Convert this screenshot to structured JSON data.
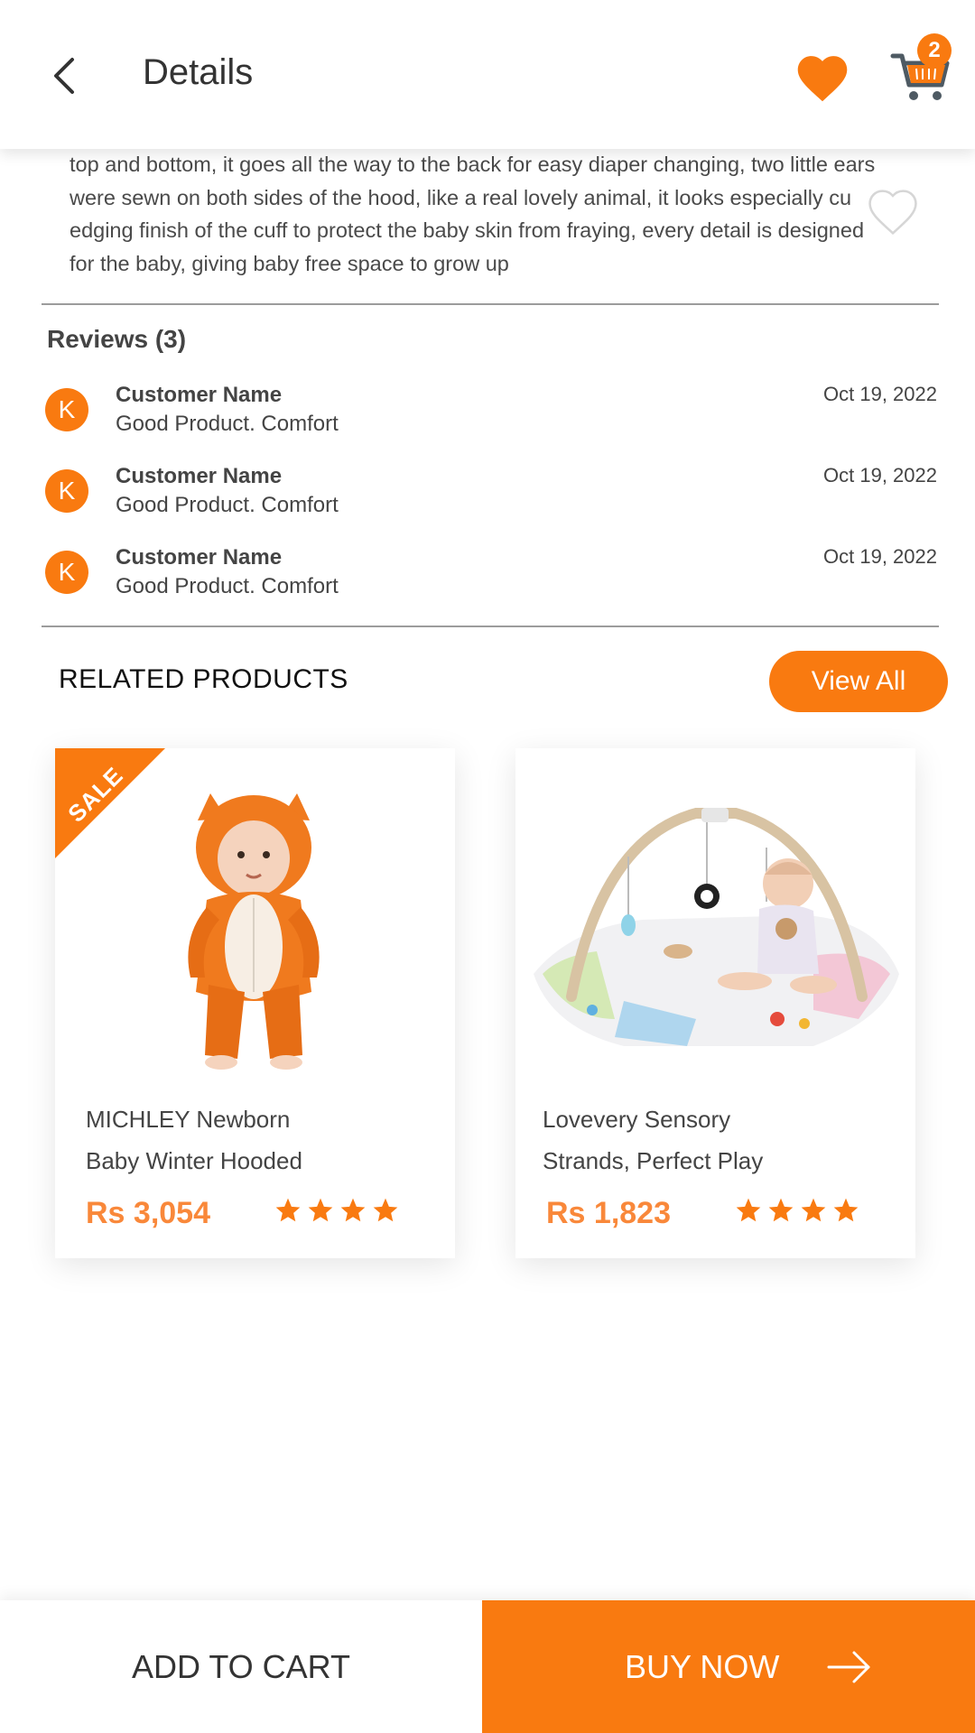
{
  "header": {
    "title": "Details",
    "cart_count": "2"
  },
  "description": {
    "lines": [
      "top and bottom, it goes all the way to the back for easy diaper changing, two little ears",
      "were sewn on both sides of the hood, like a real lovely animal, it looks especially cu",
      "edging finish of the cuff to protect the baby skin from fraying, every detail is designed",
      "for the baby, giving baby free space to grow up"
    ]
  },
  "reviews": {
    "title": "Reviews (3)",
    "items": [
      {
        "initial": "K",
        "name": "Customer Name",
        "text": "Good Product. Comfort",
        "date": "Oct 19, 2022"
      },
      {
        "initial": "K",
        "name": "Customer Name",
        "text": "Good Product. Comfort",
        "date": "Oct 19, 2022"
      },
      {
        "initial": "K",
        "name": "Customer Name",
        "text": "Good Product. Comfort",
        "date": "Oct 19, 2022"
      }
    ]
  },
  "related": {
    "title": "RELATED PRODUCTS",
    "view_all": "View All",
    "products": [
      {
        "badge": "SALE",
        "name_line1": "MICHLEY Newborn",
        "name_line2": "Baby Winter Hooded",
        "price": "Rs 3,054",
        "rating": 4
      },
      {
        "badge": "",
        "name_line1": "Lovevery Sensory",
        "name_line2": "Strands, Perfect Play",
        "price": "Rs 1,823",
        "rating": 4
      }
    ]
  },
  "actions": {
    "add_to_cart": "ADD TO CART",
    "buy_now": "BUY NOW"
  },
  "colors": {
    "accent": "#f97a10",
    "price": "#f9883a",
    "text": "#444444",
    "divider": "#9c9c9c"
  }
}
